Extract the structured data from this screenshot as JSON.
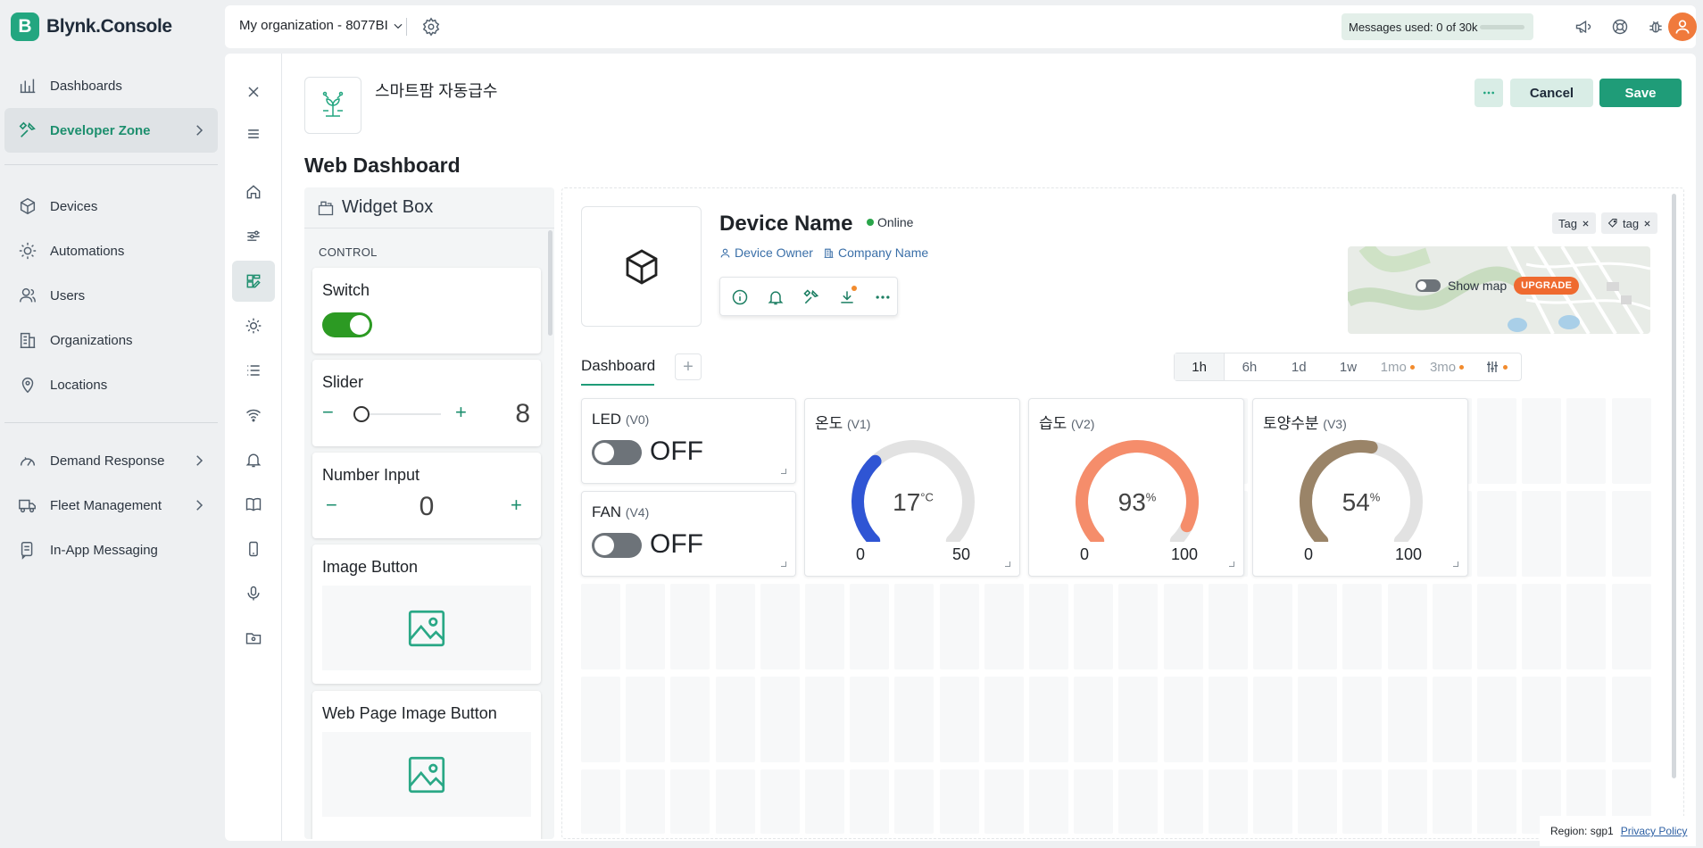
{
  "app": {
    "logo_letter": "B",
    "name": "Blynk.Console"
  },
  "nav": {
    "items": [
      {
        "label": "Dashboards",
        "icon": "chart-icon"
      },
      {
        "label": "Developer Zone",
        "icon": "tools-icon",
        "active": true
      },
      {
        "label": "Devices",
        "icon": "cube-icon"
      },
      {
        "label": "Automations",
        "icon": "sun-icon"
      },
      {
        "label": "Users",
        "icon": "users-icon"
      },
      {
        "label": "Organizations",
        "icon": "building-icon"
      },
      {
        "label": "Locations",
        "icon": "pin-icon"
      },
      {
        "label": "Demand Response",
        "icon": "gauge-icon"
      },
      {
        "label": "Fleet Management",
        "icon": "truck-icon"
      },
      {
        "label": "In-App Messaging",
        "icon": "message-icon"
      }
    ]
  },
  "topbar": {
    "org": "My organization - 8077BI",
    "messages": "Messages used: 0 of 30k"
  },
  "template": {
    "name": "스마트팜 자동급수",
    "cancel_label": "Cancel",
    "save_label": "Save",
    "section_title": "Web Dashboard"
  },
  "widget_box": {
    "title": "Widget Box",
    "category": "CONTROL",
    "switch": "Switch",
    "slider": {
      "title": "Slider",
      "minus": "−",
      "plus": "+",
      "value": "8"
    },
    "number_input": {
      "title": "Number Input",
      "minus": "−",
      "plus": "+",
      "value": "0"
    },
    "image_button": "Image Button",
    "web_page_image_button": "Web Page Image Button"
  },
  "device": {
    "name": "Device Name",
    "status": "Online",
    "owner": "Device Owner",
    "company": "Company Name",
    "tags": [
      "Tag",
      "tag"
    ],
    "map_label": "Show map",
    "upgrade": "UPGRADE"
  },
  "tabs": {
    "dashboard": "Dashboard",
    "add": "+"
  },
  "time_ranges": [
    {
      "label": "1h",
      "active": true
    },
    {
      "label": "6h"
    },
    {
      "label": "1d"
    },
    {
      "label": "1w"
    },
    {
      "label": "1mo",
      "locked": true
    },
    {
      "label": "3mo",
      "locked": true
    }
  ],
  "widgets": {
    "led": {
      "label": "LED",
      "pin": "(V0)",
      "state": "OFF"
    },
    "fan": {
      "label": "FAN",
      "pin": "(V4)",
      "state": "OFF"
    },
    "gauges": [
      {
        "label": "온도",
        "pin": "(V1)",
        "value": "17",
        "unit": "°C",
        "min": "0",
        "max": "50",
        "fraction": 0.34,
        "color": "#2f55d4"
      },
      {
        "label": "습도",
        "pin": "(V2)",
        "value": "93",
        "unit": "%",
        "min": "0",
        "max": "100",
        "fraction": 0.93,
        "color": "#f58d6b"
      },
      {
        "label": "토양수분",
        "pin": "(V3)",
        "value": "54",
        "unit": "%",
        "min": "0",
        "max": "100",
        "fraction": 0.54,
        "color": "#9a8468"
      }
    ]
  },
  "footer": {
    "region": "Region: sgp1",
    "privacy": "Privacy Policy"
  }
}
